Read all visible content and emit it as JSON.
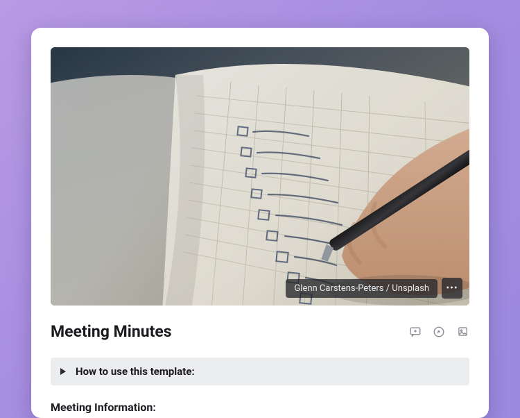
{
  "cover": {
    "attribution": "Glenn Carstens-Peters / Unsplash",
    "more_label": "•••"
  },
  "page": {
    "title": "Meeting Minutes"
  },
  "callout": {
    "label": "How to use this template:"
  },
  "sections": {
    "meeting_info_heading": "Meeting Information:"
  }
}
